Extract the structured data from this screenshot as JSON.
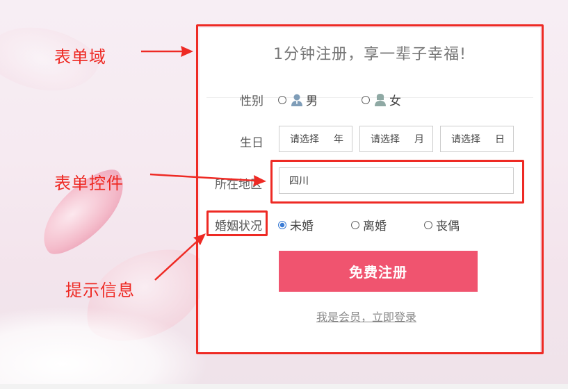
{
  "annotations": {
    "form_domain": "表单域",
    "form_control": "表单控件",
    "hint_info": "提示信息",
    "color": "#ee2a24"
  },
  "form": {
    "title": "1分钟注册，享一辈子幸福!",
    "gender": {
      "label": "性别",
      "options": [
        {
          "label": "男",
          "icon": "male-user-icon",
          "checked": false
        },
        {
          "label": "女",
          "icon": "female-user-icon",
          "checked": false
        }
      ]
    },
    "birthday": {
      "label": "生日",
      "year": {
        "value": "请选择",
        "unit": "年"
      },
      "month": {
        "value": "请选择",
        "unit": "月"
      },
      "day": {
        "value": "请选择",
        "unit": "日"
      }
    },
    "location": {
      "label": "所在地区",
      "value": "四川"
    },
    "marital": {
      "label": "婚姻状况",
      "options": [
        {
          "label": "未婚",
          "checked": true
        },
        {
          "label": "离婚",
          "checked": false
        },
        {
          "label": "丧偶",
          "checked": false
        }
      ]
    },
    "submit_label": "免费注册",
    "login_link": "我是会员，立即登录",
    "accent_color": "#f0546f"
  }
}
